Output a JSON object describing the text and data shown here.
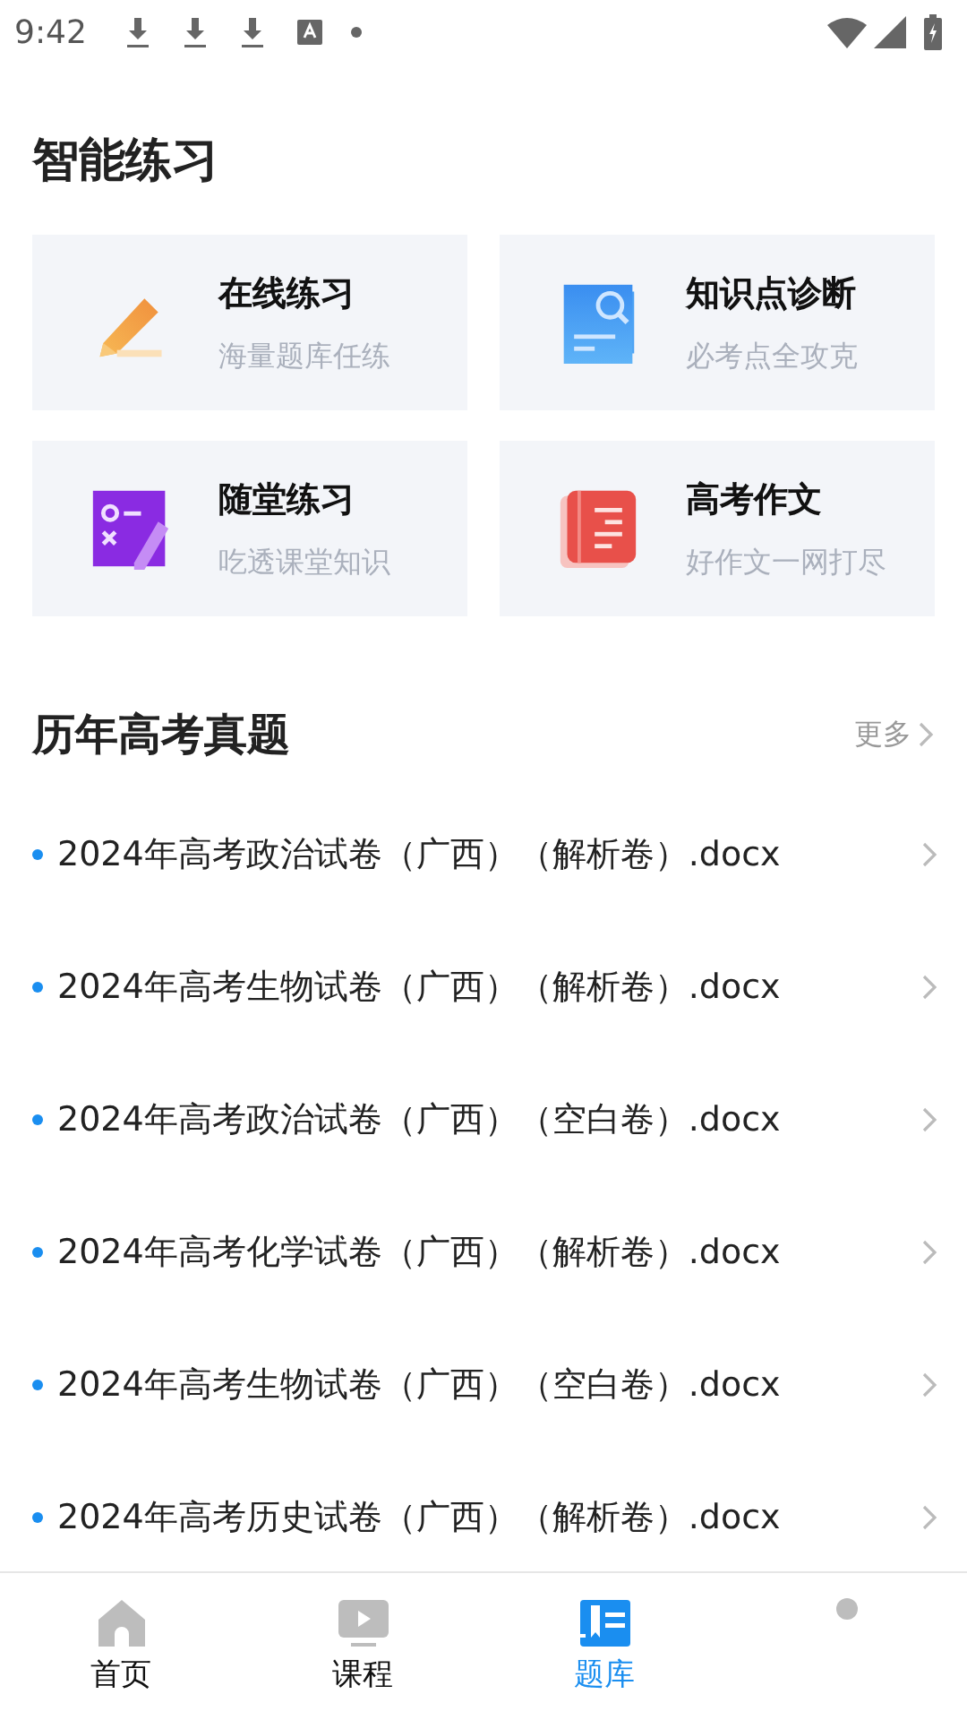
{
  "status_bar": {
    "time": "9:42"
  },
  "practice": {
    "title": "智能练习",
    "cards": [
      {
        "kind": "pencil",
        "title": "在线练习",
        "subtitle": "海量题库任练"
      },
      {
        "kind": "search-doc",
        "title": "知识点诊断",
        "subtitle": "必考点全攻克"
      },
      {
        "kind": "worksheet",
        "title": "随堂练习",
        "subtitle": "吃透课堂知识"
      },
      {
        "kind": "book",
        "title": "高考作文",
        "subtitle": "好作文一网打尽"
      }
    ]
  },
  "exams": {
    "title": "历年高考真题",
    "more": "更多",
    "items": [
      "2024年高考政治试卷（广西）（解析卷）.docx",
      "2024年高考生物试卷（广西）（解析卷）.docx",
      "2024年高考政治试卷（广西）（空白卷）.docx",
      "2024年高考化学试卷（广西）（解析卷）.docx",
      "2024年高考生物试卷（广西）（空白卷）.docx",
      "2024年高考历史试卷（广西）（解析卷）.docx"
    ]
  },
  "tabbar": [
    {
      "kind": "home",
      "label": "首页",
      "selected": false
    },
    {
      "kind": "course",
      "label": "课程",
      "selected": false
    },
    {
      "kind": "bank",
      "label": "题库",
      "selected": true
    },
    {
      "kind": "profile",
      "selected": false
    }
  ]
}
